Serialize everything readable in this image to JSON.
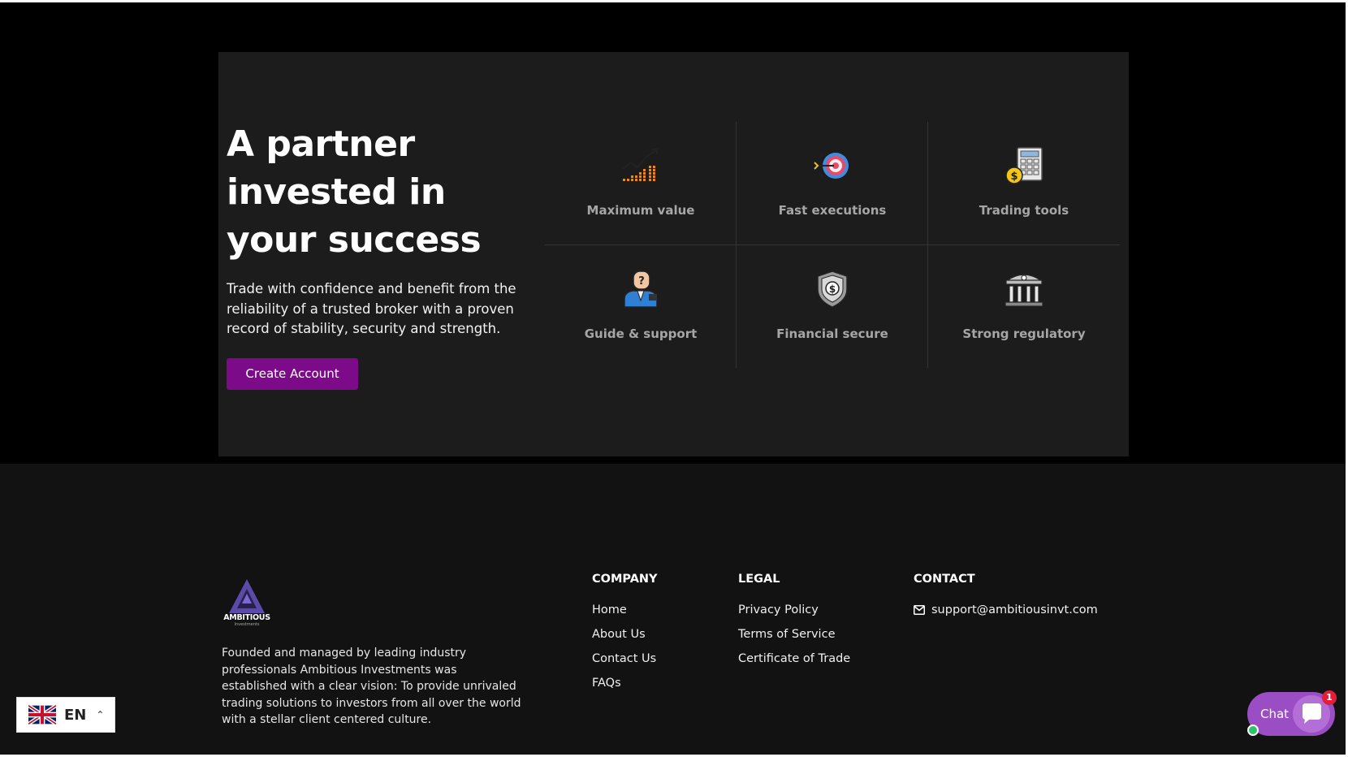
{
  "hero": {
    "title": "A partner invested in your success",
    "description": "Trade with confidence and benefit from the reliability of a trusted broker with a proven record of stability, security and strength.",
    "cta_label": "Create Account",
    "accent_color": "#7d0a88"
  },
  "features": [
    {
      "label": "Maximum value",
      "icon": "growth-chart-icon"
    },
    {
      "label": "Fast executions",
      "icon": "target-icon"
    },
    {
      "label": "Trading tools",
      "icon": "calculator-icon"
    },
    {
      "label": "Guide & support",
      "icon": "support-agent-icon"
    },
    {
      "label": "Financial secure",
      "icon": "shield-dollar-icon"
    },
    {
      "label": "Strong regulatory",
      "icon": "bank-building-icon"
    }
  ],
  "footer": {
    "logo_text": "AMBITIOUS",
    "logo_subtext": "Investments",
    "about": "Founded and managed by leading industry professionals Ambitious Investments was established with a clear vision: To provide unrivaled trading solutions to investors from all over the world with a stellar client centered culture.",
    "company": {
      "heading": "COMPANY",
      "links": [
        "Home",
        "About Us",
        "Contact Us",
        "FAQs"
      ]
    },
    "legal": {
      "heading": "LEGAL",
      "links": [
        "Privacy Policy",
        "Terms of Service",
        "Certificate of Trade"
      ]
    },
    "contact": {
      "heading": "CONTACT",
      "email": "support@ambitiousinvt.com"
    }
  },
  "language": {
    "code": "EN",
    "flag": "uk-flag-icon"
  },
  "chat": {
    "label": "Chat",
    "badge_count": "1",
    "color": "#9b4ec4"
  }
}
